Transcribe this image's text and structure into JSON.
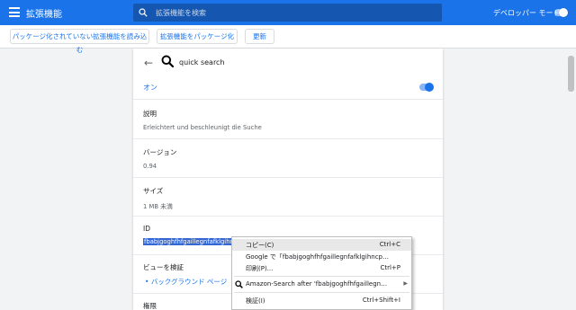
{
  "header": {
    "title": "拡張機能",
    "search_placeholder": "拡張機能を検索",
    "devmode_label": "デベロッパー モード"
  },
  "toolbar": {
    "load_unpacked": "パッケージ化されていない拡張機能を読み込む",
    "pack_extension": "拡張機能をパッケージ化",
    "update": "更新"
  },
  "detail": {
    "back_icon": "←",
    "name": "quick search",
    "on_label": "オン",
    "description_title": "説明",
    "description_value": "Erleichtert und beschleunigt die Suche",
    "version_title": "バージョン",
    "version_value": "0.94",
    "size_title": "サイズ",
    "size_value": "1 MB 未満",
    "id_title": "ID",
    "id_value": "fbabjgoghfhfgaillegnfafklgihncpc",
    "inspect_title": "ビューを検証",
    "inspect_link": "バックグラウンド ページ",
    "permissions_title": "権限"
  },
  "context_menu": {
    "items": [
      {
        "label": "コピー(C)",
        "shortcut": "Ctrl+C"
      },
      {
        "label": "Google で「fbabjgoghfhfgaillegnfafklgihncp…",
        "shortcut": ""
      },
      {
        "label": "印刷(P)...",
        "shortcut": "Ctrl+P"
      },
      {
        "label": "Amazon-Search after 'fbabjgoghfhfgaillegn…",
        "shortcut": ""
      },
      {
        "label": "検証(I)",
        "shortcut": "Ctrl+Shift+I"
      }
    ]
  },
  "colors": {
    "header_bg": "#1a73e8",
    "accent": "#1a73e8",
    "selection": "#3367d6"
  }
}
